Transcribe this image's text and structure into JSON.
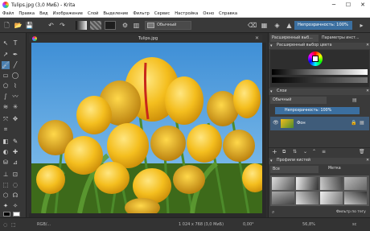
{
  "window": {
    "title": "Tulips.jpg (3,0 МиБ) - Krita",
    "minimize": "─",
    "maximize": "☐",
    "close": "✕"
  },
  "menu": [
    "Файл",
    "Правка",
    "Вид",
    "Изображение",
    "Слой",
    "Выделение",
    "Фильтр",
    "Сервис",
    "Настройка",
    "Окно",
    "Справка"
  ],
  "toolbar": {
    "blend_mode": "Обычный",
    "opacity_label": "Непрозрачность: 100%",
    "colors": {
      "fg": "#111111",
      "bg": "#ffffff",
      "accent": "#3b6fa0"
    }
  },
  "document": {
    "tab_title": "Tulips.jpg",
    "close": "✕"
  },
  "status": {
    "color_model": "RGB/...",
    "size": "1 024 x 768 (3,0 МиБ)",
    "angle": "0,00°",
    "zoom": "56,8%",
    "extra": "sc"
  },
  "right": {
    "tabs": [
      "Расширенный выб...",
      "Параметры инст..."
    ],
    "color_panel": "Расширенный выбор цвета",
    "layers_panel": "Слои",
    "layer_mode": "Обычный",
    "layer_opacity": "Непрозрачность: 100%",
    "layer_name": "Фон",
    "brushes_panel": "Профили кистей",
    "brush_tag": "Все",
    "brush_tag_btn": "Метка",
    "brush_filter": "Фильтр по тегу"
  }
}
